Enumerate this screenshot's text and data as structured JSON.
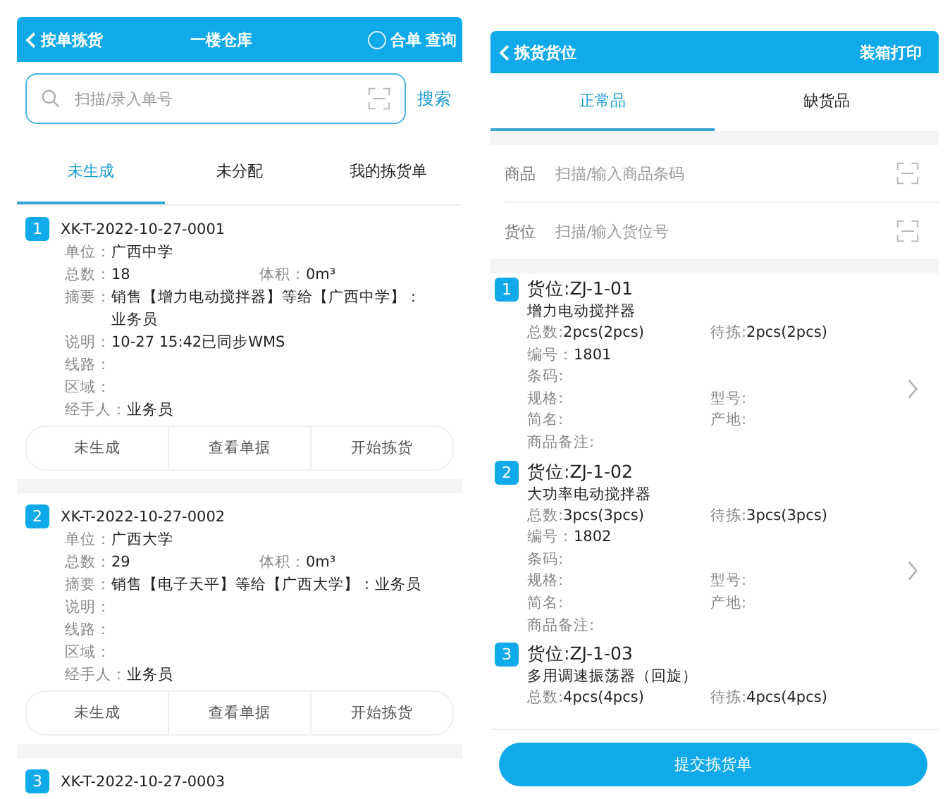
{
  "left": {
    "header": {
      "back_label": "按单拣货",
      "title": "一楼仓库",
      "merge": {
        "label": "合单",
        "checked": false
      },
      "query": "查询"
    },
    "search": {
      "placeholder": "扫描/录入单号",
      "button": "搜索"
    },
    "tabs": [
      {
        "label": "未生成",
        "selected": true
      },
      {
        "label": "未分配",
        "selected": false
      },
      {
        "label": "我的拣货单",
        "selected": false
      }
    ],
    "orders": [
      {
        "index": "1",
        "number": "XK-T-2022-10-27-0001",
        "rows": [
          [
            {
              "label": "单位：",
              "value": "广西中学"
            }
          ],
          [
            {
              "label": "总数：",
              "value": "18"
            },
            {
              "label": "体积：",
              "value": "0m³"
            }
          ],
          [
            {
              "label": "摘要：",
              "value": "销售【增力电动搅拌器】等给【广西中学】：业务员"
            }
          ],
          [
            {
              "label": "说明：",
              "value": "10-27 15:42已同步WMS"
            }
          ],
          [
            {
              "label": "线路："
            }
          ],
          [
            {
              "label": "区域："
            }
          ],
          [
            {
              "label": "经手人：",
              "value": "业务员"
            }
          ]
        ],
        "actions": [
          "未生成",
          "查看单据",
          "开始拣货"
        ]
      },
      {
        "index": "2",
        "number": "XK-T-2022-10-27-0002",
        "rows": [
          [
            {
              "label": "单位：",
              "value": "广西大学"
            }
          ],
          [
            {
              "label": "总数：",
              "value": "29"
            },
            {
              "label": "体积：",
              "value": "0m³"
            }
          ],
          [
            {
              "label": "摘要：",
              "value": "销售【电子天平】等给【广西大学】：业务员"
            }
          ],
          [
            {
              "label": "说明："
            }
          ],
          [
            {
              "label": "线路："
            }
          ],
          [
            {
              "label": "区域："
            }
          ],
          [
            {
              "label": "经手人：",
              "value": "业务员"
            }
          ]
        ],
        "actions": [
          "未生成",
          "查看单据",
          "开始拣货"
        ]
      },
      {
        "index": "3",
        "number": "XK-T-2022-10-27-0003"
      }
    ]
  },
  "right": {
    "header": {
      "back_label": "拣货货位",
      "action": "装箱打印"
    },
    "tabs": [
      {
        "label": "正常品",
        "selected": true
      },
      {
        "label": "缺货品",
        "selected": false
      }
    ],
    "scan_fields": [
      {
        "label": "商品",
        "placeholder": "扫描/输入商品条码"
      },
      {
        "label": "货位",
        "placeholder": "扫描/输入货位号"
      }
    ],
    "items": [
      {
        "index": "1",
        "location": "货位:ZJ-1-01",
        "name": "增力电动搅拌器",
        "has_arrow": true,
        "rows": [
          [
            {
              "label": "总数:",
              "value": "2pcs(2pcs)"
            },
            {
              "label": "待拣:",
              "value": "2pcs(2pcs)"
            }
          ],
          [
            {
              "label": "编号：",
              "value": "1801"
            }
          ],
          [
            {
              "label": "条码:"
            }
          ],
          [
            {
              "label": "规格:"
            },
            {
              "label": "型号:"
            }
          ],
          [
            {
              "label": "简名:"
            },
            {
              "label": "产地:"
            }
          ],
          [
            {
              "label": "商品备注:"
            }
          ]
        ]
      },
      {
        "index": "2",
        "location": "货位:ZJ-1-02",
        "name": "大功率电动搅拌器",
        "has_arrow": true,
        "rows": [
          [
            {
              "label": "总数:",
              "value": "3pcs(3pcs)"
            },
            {
              "label": "待拣:",
              "value": "3pcs(3pcs)"
            }
          ],
          [
            {
              "label": "编号：",
              "value": "1802"
            }
          ],
          [
            {
              "label": "条码:"
            }
          ],
          [
            {
              "label": "规格:"
            },
            {
              "label": "型号:"
            }
          ],
          [
            {
              "label": "简名:"
            },
            {
              "label": "产地:"
            }
          ],
          [
            {
              "label": "商品备注:"
            }
          ]
        ]
      },
      {
        "index": "3",
        "location": "货位:ZJ-1-03",
        "name": "多用调速振荡器（回旋）",
        "has_arrow": false,
        "rows": [
          [
            {
              "label": "总数:",
              "value": "4pcs(4pcs)"
            },
            {
              "label": "待拣:",
              "value": "4pcs(4pcs)"
            }
          ]
        ]
      }
    ],
    "submit": "提交拣货单"
  }
}
